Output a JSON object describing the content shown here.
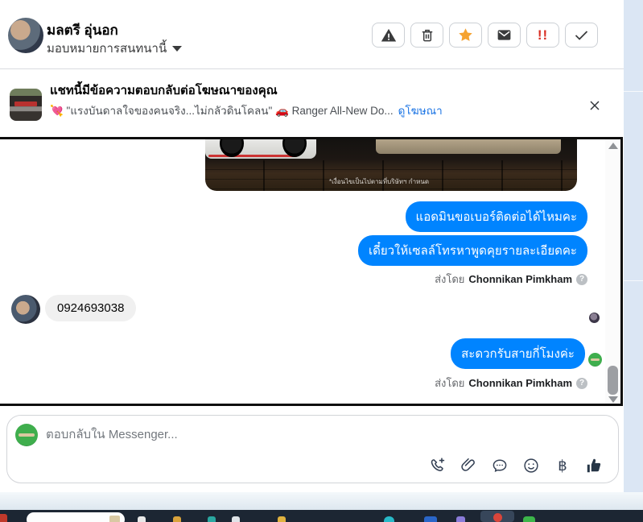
{
  "header": {
    "name": "มลตรี อุ่นอก",
    "assign_label": "มอบหมายการสนทนานี้",
    "icons": {
      "double_exclamation": "!!"
    },
    "action_colors": {
      "star_orange": "#f5a331",
      "alert_red": "#d93025",
      "icon_dark": "#3a3b3c"
    }
  },
  "ad_banner": {
    "title": "แชทนี้มีข้อความตอบกลับต่อโฆษณาของคุณ",
    "subtitle": "💘 \"แรงบันดาลใจของคนจริง...ไม่กลัวดินโคลน\" 🚗 Ranger All-New Do...",
    "link_label": "ดูโฆษณา",
    "link_color": "#1b74e4"
  },
  "chat": {
    "ad_image_caption": "*เงื่อนไขเป็นไปตามที่บริษัทฯ กำหนด",
    "outgoing_messages": [
      "แอดมินขอเบอร์ติดต่อได้ไหมคะ",
      "เดี๋ยวให้เซลล์โทรหาพูดคุยรายละเอียดคะ",
      "สะดวกรับสายกี่โมงค่ะ"
    ],
    "incoming_message": "0924693038",
    "sent_by_label": "ส่งโดย",
    "sender_name": "Chonnikan Pimkham",
    "help_icon": "?",
    "bubble_color": "#0084ff"
  },
  "composer": {
    "placeholder": "ตอบกลับใน Messenger...",
    "icons": {
      "baht": "฿"
    }
  }
}
